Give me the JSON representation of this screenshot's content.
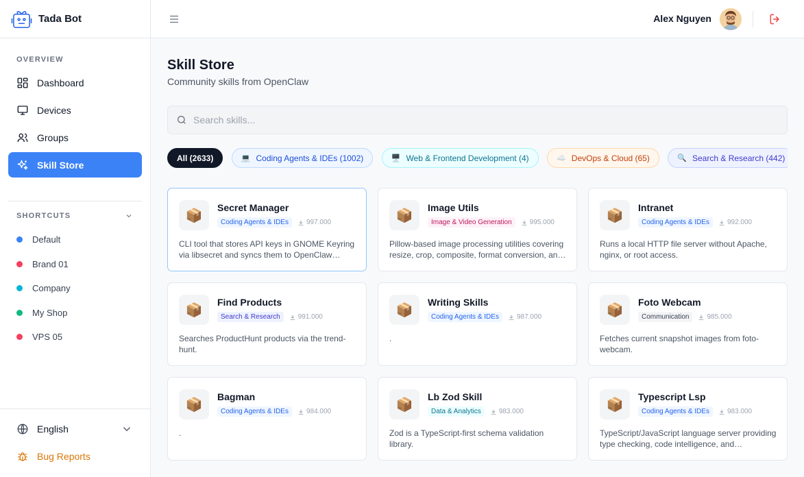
{
  "app": {
    "name": "Tada Bot"
  },
  "sidebar": {
    "overview_label": "OVERVIEW",
    "nav": [
      {
        "label": "Dashboard",
        "icon": "dashboard-icon"
      },
      {
        "label": "Devices",
        "icon": "monitor-icon"
      },
      {
        "label": "Groups",
        "icon": "users-icon"
      },
      {
        "label": "Skill Store",
        "icon": "sparkles-icon",
        "active": true
      }
    ],
    "shortcuts_label": "SHORTCUTS",
    "shortcuts": [
      {
        "label": "Default",
        "color": "#3b82f6"
      },
      {
        "label": "Brand 01",
        "color": "#f43f5e"
      },
      {
        "label": "Company",
        "color": "#06b6d4"
      },
      {
        "label": "My Shop",
        "color": "#10b981"
      },
      {
        "label": "VPS 05",
        "color": "#f43f5e"
      }
    ],
    "language": "English",
    "bug_reports": "Bug Reports"
  },
  "header": {
    "user_name": "Alex Nguyen"
  },
  "main": {
    "title": "Skill Store",
    "subtitle": "Community skills from OpenClaw",
    "search_placeholder": "Search skills...",
    "categories": [
      {
        "label": "All (2633)",
        "active": true
      },
      {
        "label": "Coding Agents & IDEs (1002)",
        "emoji": "💻",
        "bg": "#eff6ff",
        "border": "#bfdbfe",
        "color": "#1d4ed8"
      },
      {
        "label": "Web & Frontend Development (4)",
        "emoji": "🖥️",
        "bg": "#ecfeff",
        "border": "#a5f3fc",
        "color": "#0e7490"
      },
      {
        "label": "DevOps & Cloud (65)",
        "emoji": "☁️",
        "bg": "#fff7ed",
        "border": "#fed7aa",
        "color": "#c2410c"
      },
      {
        "label": "Search & Research (442)",
        "emoji": "🔍",
        "bg": "#eef2ff",
        "border": "#c7d2fe",
        "color": "#4338ca"
      },
      {
        "label": "🤖",
        "emoji": "",
        "bg": "#ffffff",
        "border": "#e5e7eb",
        "color": "#6b7280"
      }
    ],
    "skills": [
      {
        "name": "Secret Manager",
        "tag": "Coding Agents & IDEs",
        "tag_bg": "#eff6ff",
        "tag_color": "#2563eb",
        "downloads": "997.000",
        "desc": "CLI tool that stores API keys in GNOME Keyring via libsecret and syncs them to OpenClaw configuration files."
      },
      {
        "name": "Image Utils",
        "tag": "Image & Video Generation",
        "tag_bg": "#fdf2f8",
        "tag_color": "#be185d",
        "downloads": "995.000",
        "desc": "Pillow-based image processing utilities covering resize, crop, composite, format conversion, and more."
      },
      {
        "name": "Intranet",
        "tag": "Coding Agents & IDEs",
        "tag_bg": "#eff6ff",
        "tag_color": "#2563eb",
        "downloads": "992.000",
        "desc": "Runs a local HTTP file server without Apache, nginx, or root access."
      },
      {
        "name": "Find Products",
        "tag": "Search & Research",
        "tag_bg": "#eef2ff",
        "tag_color": "#4338ca",
        "downloads": "991.000",
        "desc": "Searches ProductHunt products via the trend-hunt."
      },
      {
        "name": "Writing Skills",
        "tag": "Coding Agents & IDEs",
        "tag_bg": "#eff6ff",
        "tag_color": "#2563eb",
        "downloads": "987.000",
        "desc": "."
      },
      {
        "name": "Foto Webcam",
        "tag": "Communication",
        "tag_bg": "#f3f4f6",
        "tag_color": "#374151",
        "downloads": "985.000",
        "desc": "Fetches current snapshot images from foto-webcam."
      },
      {
        "name": "Bagman",
        "tag": "Coding Agents & IDEs",
        "tag_bg": "#eff6ff",
        "tag_color": "#2563eb",
        "downloads": "984.000",
        "desc": "."
      },
      {
        "name": "Lb Zod Skill",
        "tag": "Data & Analytics",
        "tag_bg": "#ecfeff",
        "tag_color": "#0e7490",
        "downloads": "983.000",
        "desc": "Zod is a TypeScript-first schema validation library."
      },
      {
        "name": "Typescript Lsp",
        "tag": "Coding Agents & IDEs",
        "tag_bg": "#eff6ff",
        "tag_color": "#2563eb",
        "downloads": "983.000",
        "desc": "TypeScript/JavaScript language server providing type checking, code intelligence, and diagnostics."
      }
    ],
    "skill_icon": "📦"
  }
}
